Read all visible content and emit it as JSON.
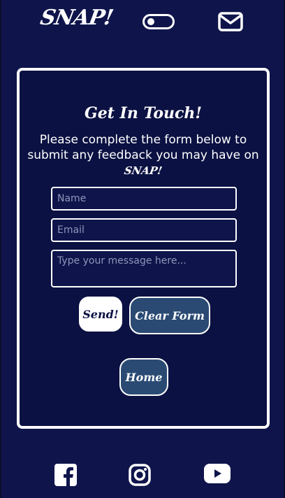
{
  "header": {
    "logo": "SNAP!",
    "theme_toggle_icon": "toggle-icon",
    "mail_icon": "mail-icon"
  },
  "form": {
    "title": "Get In Touch!",
    "description": "Please complete the form below to submit any feedback you may have on",
    "brand": "SNAP!",
    "name_placeholder": "Name",
    "email_placeholder": "Email",
    "message_placeholder": "Type your message here...",
    "send_label": "Send!",
    "clear_label": "Clear Form",
    "home_label": "Home"
  },
  "footer": {
    "icons": [
      "facebook-icon",
      "instagram-icon",
      "youtube-icon"
    ]
  },
  "colors": {
    "background": "#0f154b",
    "card": "#0b1142",
    "button_accent": "#2a4a73",
    "text": "#ffffff"
  }
}
